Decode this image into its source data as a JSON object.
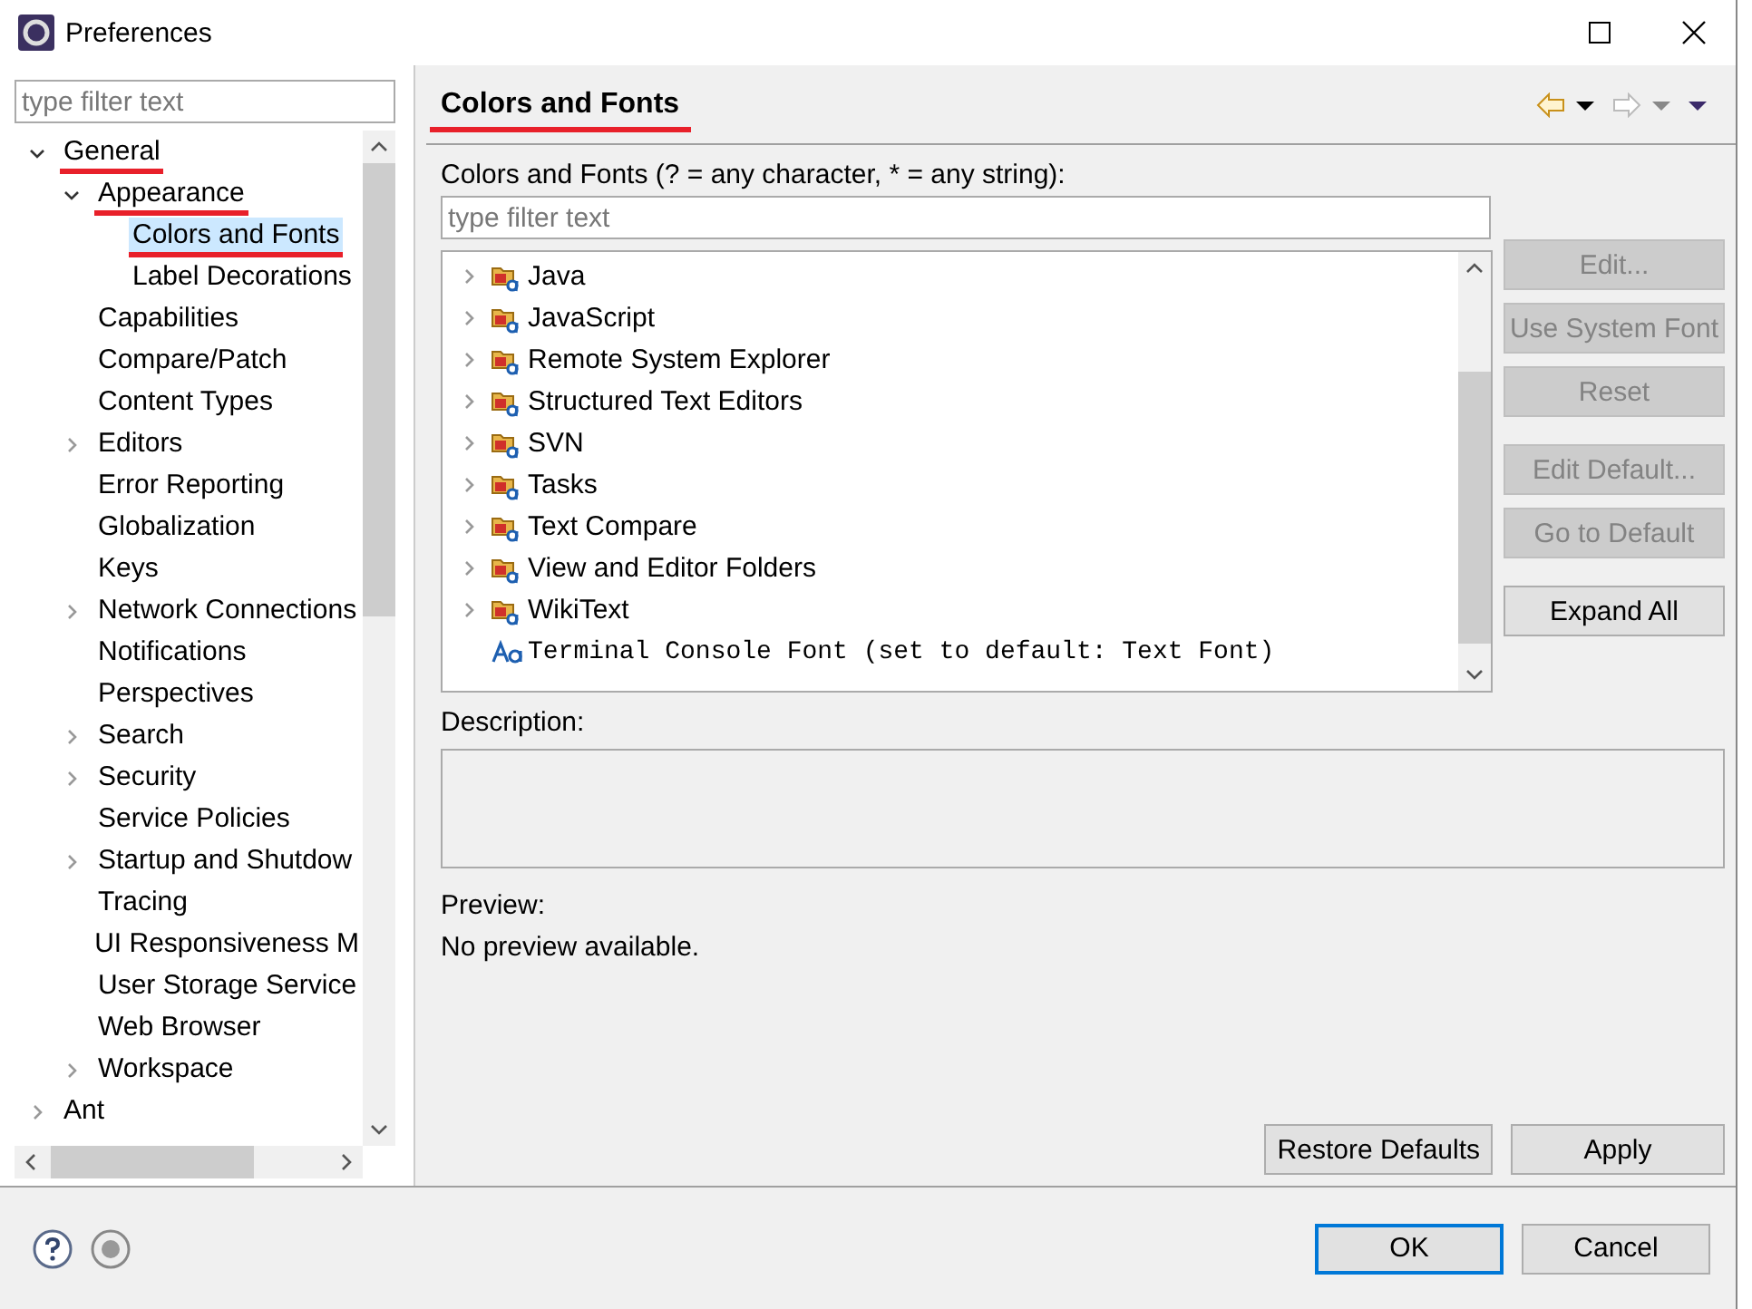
{
  "window": {
    "title": "Preferences"
  },
  "sidebar": {
    "filter": {
      "placeholder": "type filter text"
    },
    "tree": [
      {
        "label": "General",
        "expanded": true,
        "selected": false,
        "annotated": true,
        "children": [
          {
            "label": "Appearance",
            "expanded": true,
            "selected": false,
            "annotated": true,
            "children": [
              {
                "label": "Colors and Fonts",
                "selected": true,
                "annotated": true
              },
              {
                "label": "Label Decorations",
                "selected": false,
                "annotated": false
              }
            ]
          },
          {
            "label": "Capabilities",
            "selected": false,
            "annotated": false
          },
          {
            "label": "Compare/Patch",
            "selected": false,
            "annotated": false
          },
          {
            "label": "Content Types",
            "selected": false,
            "annotated": false
          },
          {
            "label": "Editors",
            "expanded": false,
            "selected": false,
            "annotated": false
          },
          {
            "label": "Error Reporting",
            "selected": false,
            "annotated": false
          },
          {
            "label": "Globalization",
            "selected": false,
            "annotated": false
          },
          {
            "label": "Keys",
            "selected": false,
            "annotated": false
          },
          {
            "label": "Network Connections",
            "expanded": false,
            "selected": false,
            "annotated": false
          },
          {
            "label": "Notifications",
            "selected": false,
            "annotated": false
          },
          {
            "label": "Perspectives",
            "selected": false,
            "annotated": false
          },
          {
            "label": "Search",
            "expanded": false,
            "selected": false,
            "annotated": false
          },
          {
            "label": "Security",
            "expanded": false,
            "selected": false,
            "annotated": false
          },
          {
            "label": "Service Policies",
            "selected": false,
            "annotated": false
          },
          {
            "label": "Startup and Shutdow",
            "expanded": false,
            "selected": false,
            "annotated": false
          },
          {
            "label": "Tracing",
            "selected": false,
            "annotated": false
          },
          {
            "label": "UI Responsiveness M",
            "selected": false,
            "annotated": false
          },
          {
            "label": "User Storage Service",
            "selected": false,
            "annotated": false
          },
          {
            "label": "Web Browser",
            "selected": false,
            "annotated": false
          },
          {
            "label": "Workspace",
            "expanded": false,
            "selected": false,
            "annotated": false
          }
        ]
      },
      {
        "label": "Ant",
        "expanded": false,
        "selected": false,
        "annotated": false
      }
    ]
  },
  "page": {
    "title": "Colors and Fonts",
    "title_annotated": true,
    "filter_label": "Colors and Fonts (? = any character, * = any string):",
    "filter": {
      "placeholder": "type filter text"
    },
    "items": [
      {
        "kind": "category",
        "label": "Java"
      },
      {
        "kind": "category",
        "label": "JavaScript"
      },
      {
        "kind": "category",
        "label": "Remote System Explorer"
      },
      {
        "kind": "category",
        "label": "Structured Text Editors"
      },
      {
        "kind": "category",
        "label": "SVN"
      },
      {
        "kind": "category",
        "label": "Tasks"
      },
      {
        "kind": "category",
        "label": "Text Compare"
      },
      {
        "kind": "category",
        "label": "View and Editor Folders"
      },
      {
        "kind": "category",
        "label": "WikiText"
      },
      {
        "kind": "font",
        "label": "Terminal Console Font (set to default: Text Font)"
      }
    ],
    "side_buttons": [
      {
        "label": "Edit...",
        "disabled": true
      },
      {
        "label": "Use System Font",
        "disabled": true
      },
      {
        "label": "Reset",
        "disabled": true
      },
      {
        "label": "Edit Default...",
        "disabled": true
      },
      {
        "label": "Go to Default",
        "disabled": true
      },
      {
        "label": "Expand All",
        "disabled": false
      }
    ],
    "description_label": "Description:",
    "preview_label": "Preview:",
    "preview_text": "No preview available.",
    "buttons": [
      "Restore Defaults",
      "Apply"
    ]
  },
  "footer": {
    "buttons": [
      {
        "label": "OK",
        "selected": true
      },
      {
        "label": "Cancel",
        "selected": false
      }
    ]
  }
}
